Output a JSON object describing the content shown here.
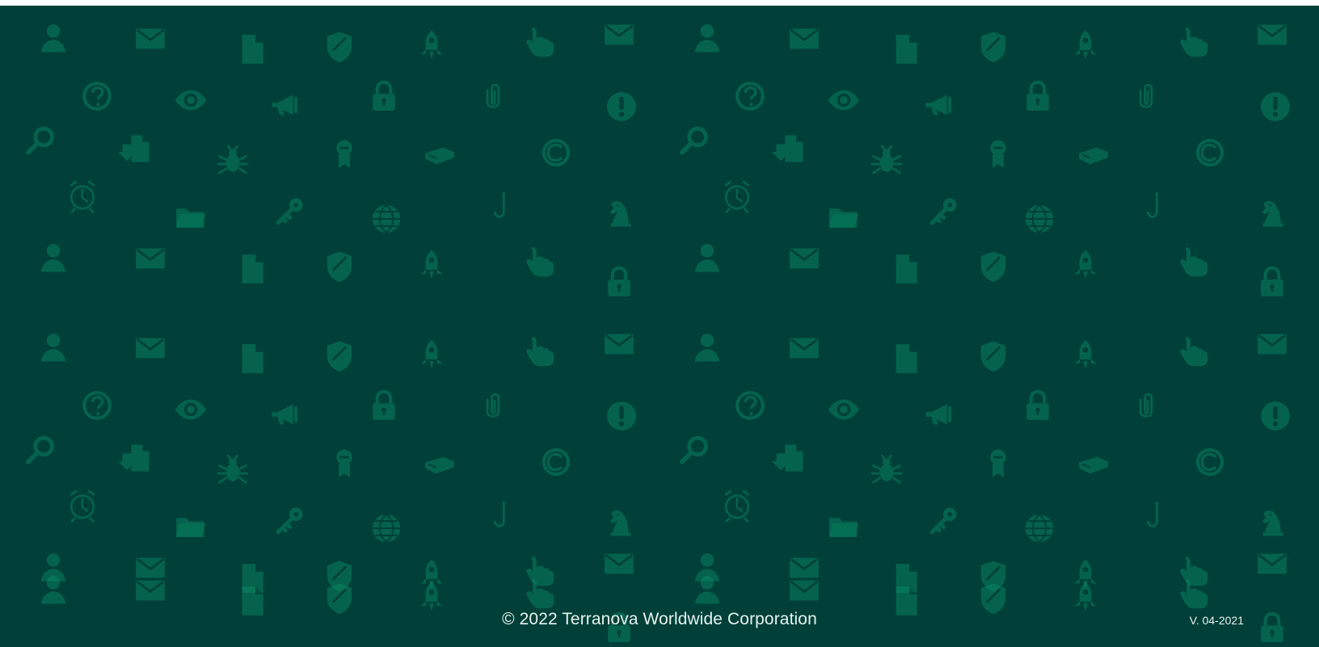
{
  "footer": {
    "copyright": "© 2022 Terranova Worldwide Corporation",
    "version": "V. 04-2021"
  },
  "colors": {
    "background": "#004038",
    "pattern_icon": "#0b8e66",
    "footer_text": "#e7f3ef"
  },
  "pattern": {
    "icon_names": [
      "user-icon",
      "envelope-icon",
      "document-icon",
      "shield-icon",
      "rocket-icon",
      "pointer-hand-icon",
      "question-icon",
      "eye-icon",
      "megaphone-icon",
      "lock-icon",
      "paperclip-icon",
      "alert-icon",
      "magnifier-icon",
      "download-document-icon",
      "bug-icon",
      "ribbon-icon",
      "book-icon",
      "copyright-icon",
      "alarm-clock-icon",
      "folder-icon",
      "key-icon",
      "globe-icon",
      "fishhook-icon",
      "chess-knight-icon"
    ]
  }
}
